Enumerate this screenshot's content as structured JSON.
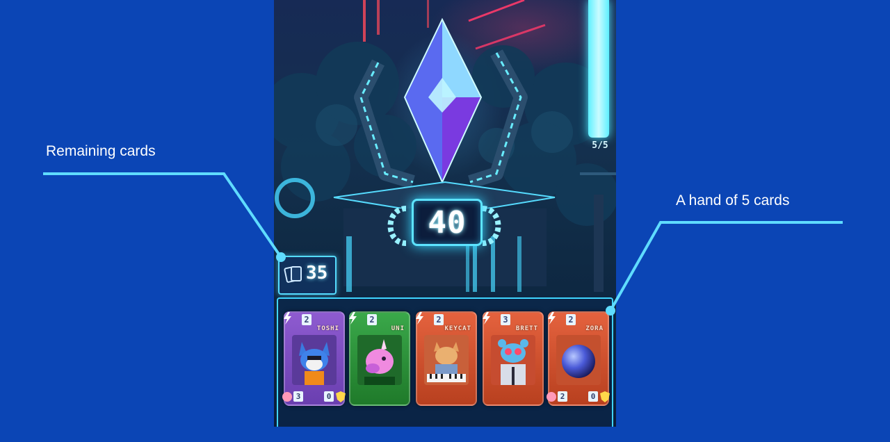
{
  "annotations": {
    "remaining_cards_label": "Remaining cards",
    "hand_label": "A hand of 5 cards"
  },
  "game": {
    "energy_readout": "5/5",
    "energy_level": 1.0,
    "score": "40",
    "deck_remaining": "35",
    "hand": [
      {
        "name": "TOSHI",
        "cost": "2",
        "attack": "3",
        "defense": "0",
        "color": "#8e5bd0",
        "art": "fox-icon"
      },
      {
        "name": "UNI",
        "cost": "2",
        "color": "#3aa84a",
        "art": "unicorn-icon"
      },
      {
        "name": "KEYCAT",
        "cost": "2",
        "color": "#e4623e",
        "art": "keyboard-cat-icon"
      },
      {
        "name": "BRETT",
        "cost": "3",
        "color": "#e4623e",
        "art": "blue-creature-icon"
      },
      {
        "name": "ZORA",
        "cost": "2",
        "attack": "2",
        "defense": "0",
        "color": "#e4623e",
        "art": "sphere-icon"
      }
    ]
  },
  "colors": {
    "background": "#0b45b5",
    "callout_line": "#5fdcff",
    "neon": "#5de4ff"
  }
}
